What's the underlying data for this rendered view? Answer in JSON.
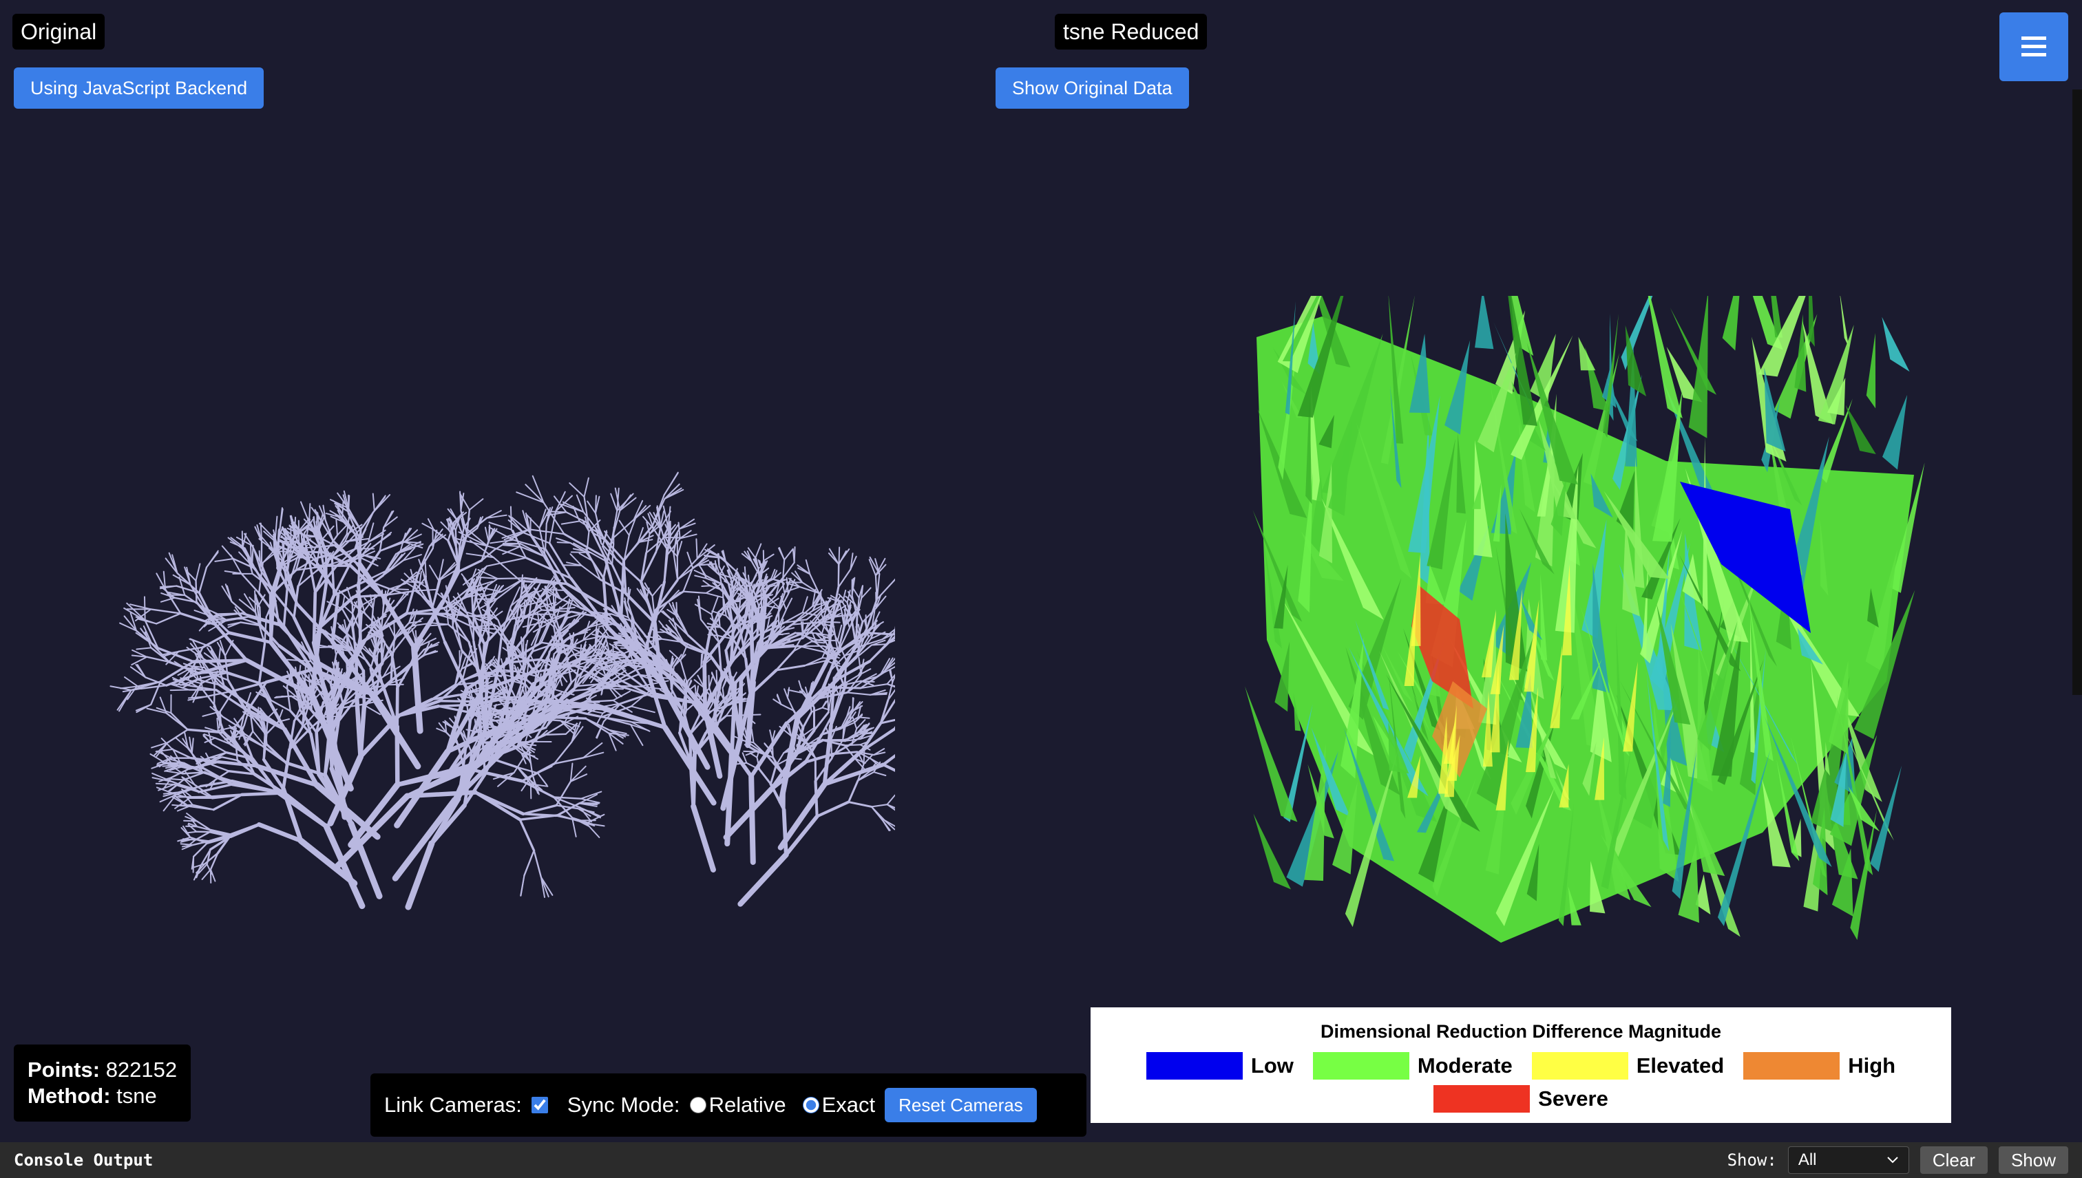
{
  "left_panel": {
    "title": "Original",
    "backend_button": "Using JavaScript Backend",
    "mesh_color": "#b9b8e0"
  },
  "right_panel": {
    "title": "tsne Reduced",
    "toggle_button": "Show Original Data"
  },
  "menu": {
    "icon": "hamburger-menu-icon"
  },
  "stats": {
    "points_label": "Points:",
    "points_value": "822152",
    "method_label": "Method:",
    "method_value": "tsne"
  },
  "camera_controls": {
    "link_label": "Link Cameras:",
    "link_checked": true,
    "sync_label": "Sync Mode:",
    "relative_label": "Relative",
    "exact_label": "Exact",
    "selected_mode": "Exact",
    "reset_button": "Reset Cameras"
  },
  "legend": {
    "title": "Dimensional Reduction Difference Magnitude",
    "items": [
      {
        "label": "Low",
        "color": "#0000ee"
      },
      {
        "label": "Moderate",
        "color": "#77ff44"
      },
      {
        "label": "Elevated",
        "color": "#ffff44"
      },
      {
        "label": "High",
        "color": "#ee8833"
      },
      {
        "label": "Severe",
        "color": "#ee3322"
      }
    ]
  },
  "console": {
    "title": "Console Output",
    "show_label": "Show:",
    "filter_value": "All",
    "clear_button": "Clear",
    "show_button": "Show"
  },
  "colors": {
    "background": "#1b1b2f",
    "accent": "#3a7ee8"
  }
}
